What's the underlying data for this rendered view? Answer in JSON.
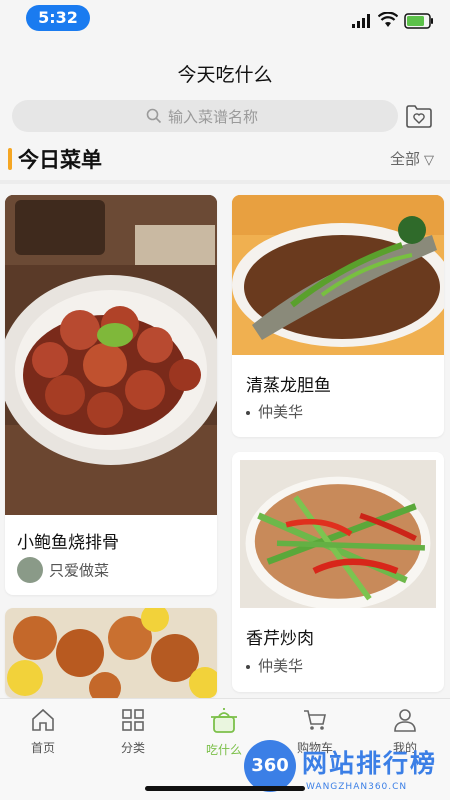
{
  "status": {
    "time": "5:32"
  },
  "nav": {
    "title": "今天吃什么"
  },
  "search": {
    "placeholder": "输入菜谱名称"
  },
  "section": {
    "title": "今日菜单",
    "filter": "全部"
  },
  "cards": [
    {
      "name": "小鲍鱼烧排骨",
      "author": "只爱做菜"
    },
    {
      "name": "清蒸龙胆鱼",
      "author": "仲美华"
    },
    {
      "name": "香芹炒肉",
      "author": "仲美华"
    }
  ],
  "tabs": [
    {
      "label": "首页",
      "icon": "home-icon"
    },
    {
      "label": "分类",
      "icon": "grid-icon"
    },
    {
      "label": "吃什么",
      "icon": "pot-icon"
    },
    {
      "label": "购物车",
      "icon": "cart-icon"
    },
    {
      "label": "我的",
      "icon": "user-icon"
    }
  ],
  "watermark": {
    "logo": "360",
    "text": "网站排行榜",
    "sub": "WANGZHAN360.CN"
  },
  "colors": {
    "accent": "#7cc04a",
    "section_bar": "#f5a623",
    "time_pill": "#1a7bf0"
  }
}
